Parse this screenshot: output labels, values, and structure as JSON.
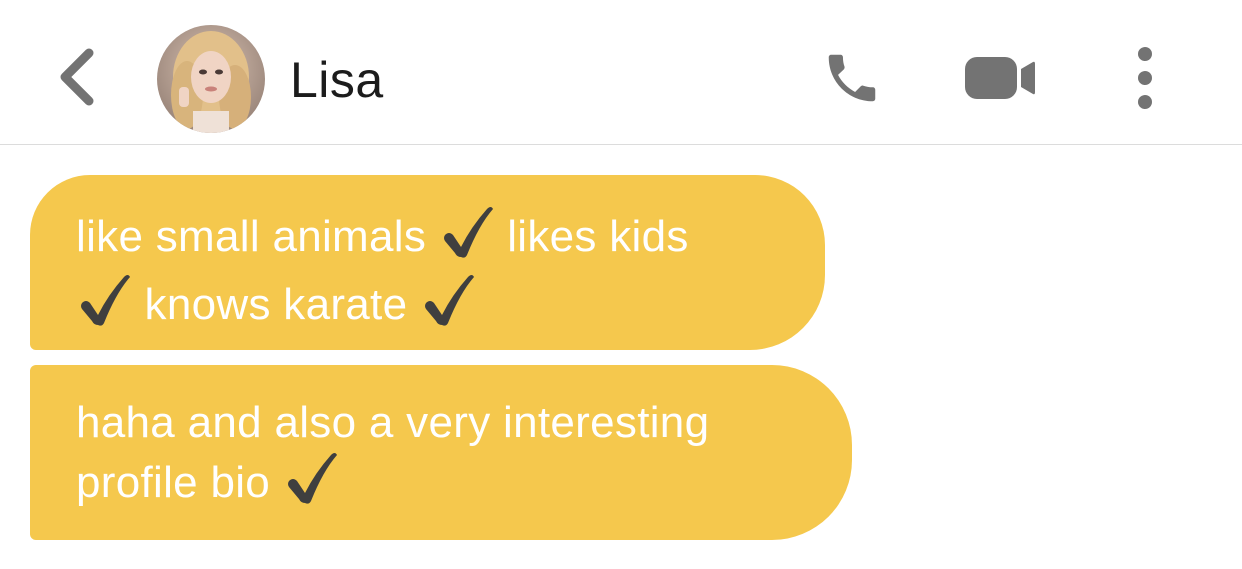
{
  "header": {
    "contact_name": "Lisa",
    "back_icon": "chevron-left-icon",
    "call_icon": "phone-icon",
    "video_icon": "video-camera-icon",
    "more_icon": "more-vertical-icon",
    "icon_color": "#737373"
  },
  "messages": [
    {
      "segments": [
        "like small animals ",
        " likes kids\n",
        " knows karate "
      ],
      "check_color": "#3f3f3f"
    },
    {
      "segments": [
        "haha and also a very interesting\nprofile bio "
      ],
      "check_color": "#3f3f3f"
    }
  ],
  "colors": {
    "bubble": "#f5c84d",
    "bubble_text": "#ffffff",
    "name_text": "#1c1c1c",
    "divider": "#dcdcdc"
  }
}
